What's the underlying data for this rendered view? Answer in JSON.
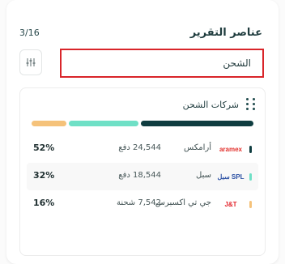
{
  "header": {
    "title": "عناصر التقرير",
    "counter": "3/16"
  },
  "search": {
    "value": "الشحن",
    "placeholder": ""
  },
  "filter_button": {
    "icon": "sliders-icon"
  },
  "card": {
    "title": "شركات الشحن",
    "stack_bar": {
      "segments": [
        {
          "color": "#0f3d40",
          "share": 0.52
        },
        {
          "color": "#6fe0c6",
          "share": 0.32
        },
        {
          "color": "#f5c27a",
          "share": 0.16
        }
      ]
    },
    "rows": [
      {
        "name": "أرامكس",
        "logo_text": "aramex",
        "logo_color": "#e2312d",
        "count": "24,544 دفع",
        "percent": "52%",
        "dot_color": "#0f3d40"
      },
      {
        "name": "سبل",
        "logo_text": "سبل SPL",
        "logo_color": "#2a4fa3",
        "count": "18,544 دفع",
        "percent": "32%",
        "dot_color": "#6fe0c6"
      },
      {
        "name": "جي تي اكسبرس",
        "logo_text": "J&T",
        "logo_color": "#e3242b",
        "count": "7,542 شحنة",
        "percent": "16%",
        "dot_color": "#f5c27a"
      }
    ]
  }
}
